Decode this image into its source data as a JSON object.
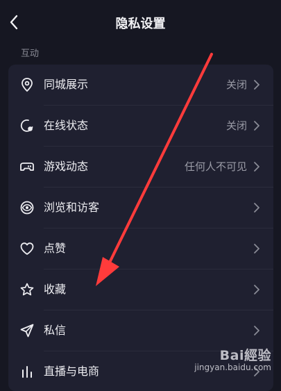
{
  "header": {
    "title": "隐私设置"
  },
  "section": {
    "label": "互动"
  },
  "items": [
    {
      "label": "同城展示",
      "value": "关闭",
      "icon": "location-pin-icon"
    },
    {
      "label": "在线状态",
      "value": "关闭",
      "icon": "online-status-icon"
    },
    {
      "label": "游戏动态",
      "value": "任何人不可见",
      "icon": "gamepad-icon"
    },
    {
      "label": "浏览和访客",
      "value": "",
      "icon": "eye-icon"
    },
    {
      "label": "点赞",
      "value": "",
      "icon": "heart-icon"
    },
    {
      "label": "收藏",
      "value": "",
      "icon": "star-icon"
    },
    {
      "label": "私信",
      "value": "",
      "icon": "send-icon"
    },
    {
      "label": "直播与电商",
      "value": "",
      "icon": "bar-chart-icon"
    }
  ],
  "watermark": {
    "brand": "Bai經验",
    "url": "jingyan.baidu.com"
  },
  "colors": {
    "background": "#161722",
    "card": "#1f2030",
    "annotation_arrow": "#ff3b3b"
  }
}
